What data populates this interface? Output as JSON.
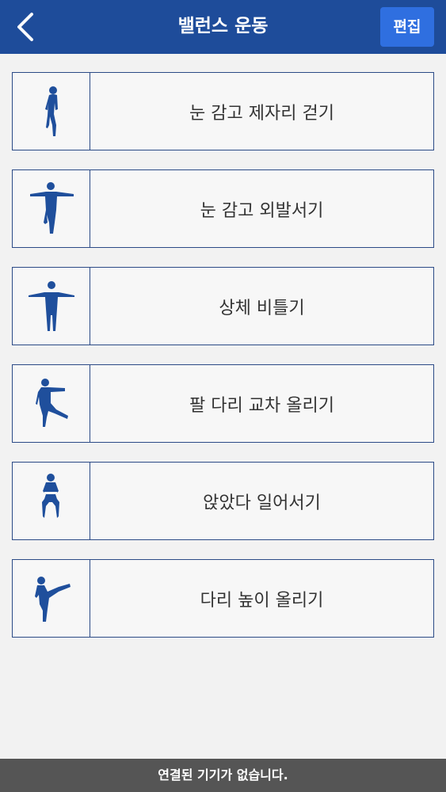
{
  "header": {
    "title": "밸런스 운동",
    "edit_label": "편집",
    "back_icon": "chevron-left-icon"
  },
  "colors": {
    "header_bg": "#1e4c9a",
    "edit_button_bg": "#2f6fe0",
    "figure": "#1f4f9c",
    "border": "#2b4a86",
    "status_bar_bg": "#555555"
  },
  "exercises": [
    {
      "label": "눈 감고 제자리 걷기",
      "icon": "walking-in-place-figure-icon"
    },
    {
      "label": "눈 감고 외발서기",
      "icon": "one-leg-stand-figure-icon"
    },
    {
      "label": "상체 비틀기",
      "icon": "torso-twist-figure-icon"
    },
    {
      "label": "팔 다리 교차 올리기",
      "icon": "cross-limb-raise-figure-icon"
    },
    {
      "label": "앉았다 일어서기",
      "icon": "squat-figure-icon"
    },
    {
      "label": "다리 높이 올리기",
      "icon": "high-leg-raise-figure-icon"
    }
  ],
  "status": {
    "text": "연결된 기기가 없습니다."
  }
}
